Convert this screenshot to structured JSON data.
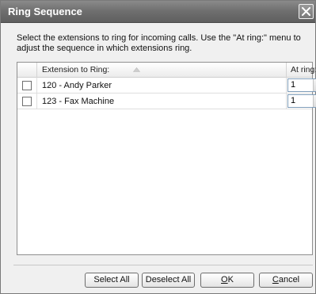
{
  "window": {
    "title": "Ring Sequence",
    "close_icon": "close-icon"
  },
  "instructions": "Select the extensions to ring for incoming calls. Use the \"At ring:\" menu to adjust the sequence in which extensions ring.",
  "table": {
    "columns": {
      "check": "",
      "extension": "Extension to Ring:",
      "at_ring": "At ring:"
    },
    "sort_icon": "sort-ascending-icon",
    "rows": [
      {
        "checked": false,
        "extension": "120 - Andy Parker",
        "at_ring": "1"
      },
      {
        "checked": false,
        "extension": "123 - Fax Machine",
        "at_ring": "1"
      }
    ]
  },
  "buttons": {
    "select_all": "Select All",
    "deselect_all": "Deselect All",
    "ok": {
      "mnemonic": "O",
      "rest": "K"
    },
    "cancel": {
      "mnemonic": "C",
      "rest": "ancel"
    }
  },
  "colors": {
    "titlebar": "#6e6e6e",
    "title_text": "#ffffff",
    "dialog_bg": "#f0f0f0"
  }
}
